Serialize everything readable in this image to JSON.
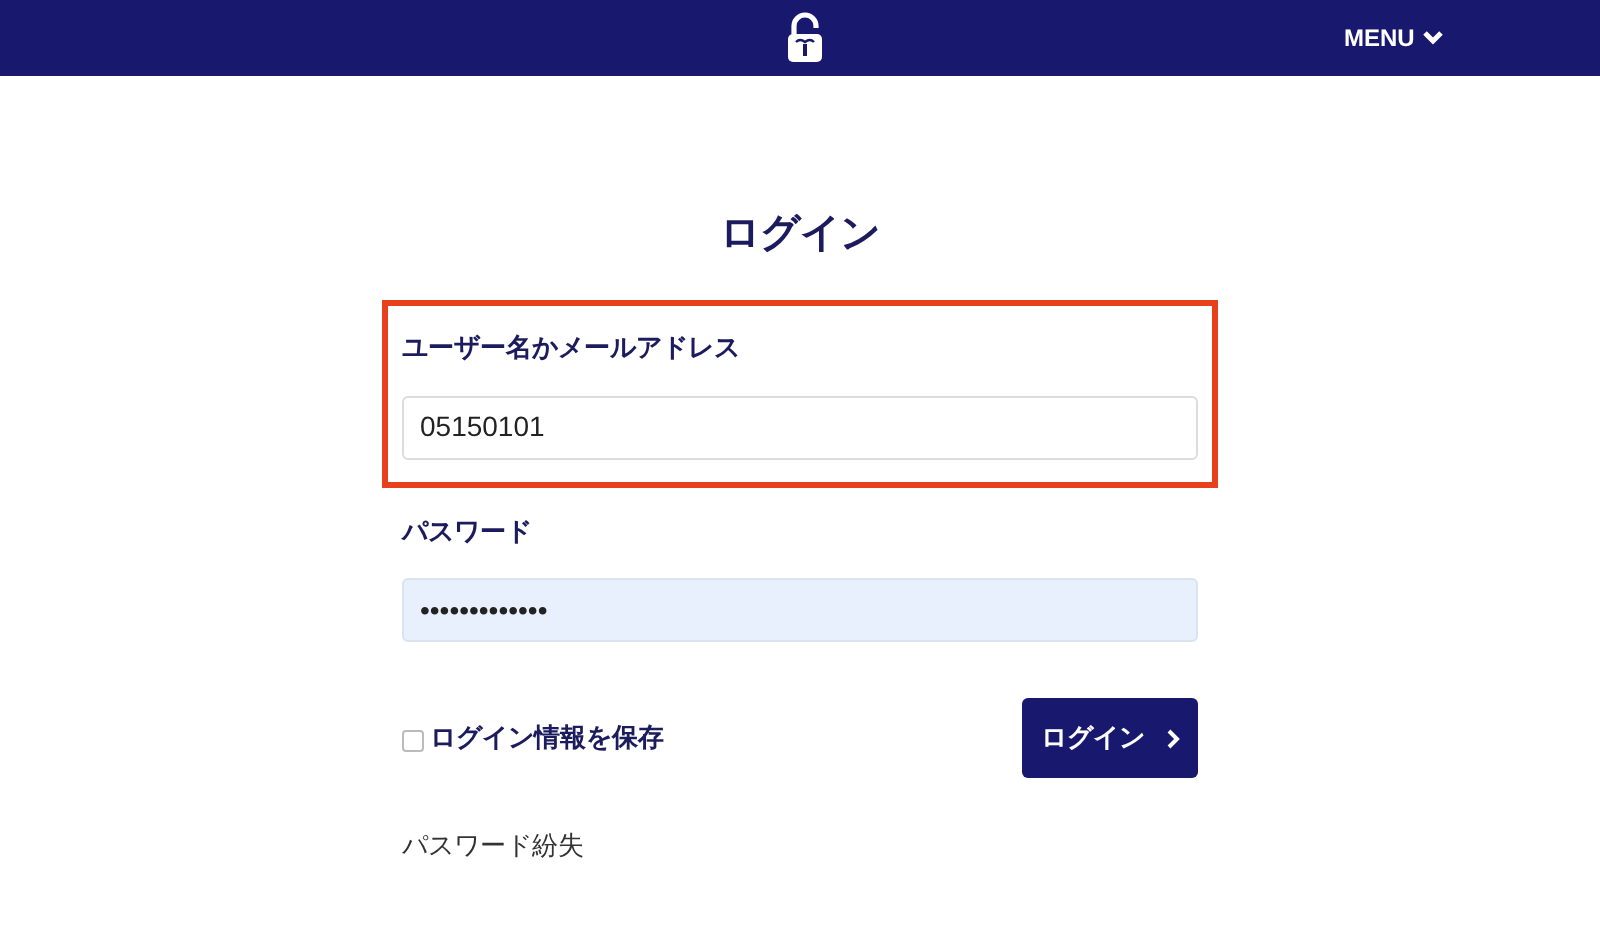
{
  "header": {
    "menu": {
      "label": "MENU",
      "expanded": false
    }
  },
  "title": "ログイン",
  "fields": [
    {
      "label": "ユーザー名かメールアドレス",
      "value": "05150101",
      "highlighted": true,
      "autofilled": false
    },
    {
      "label": "パスワード",
      "value": "•••••••••••••",
      "highlighted": false,
      "autofilled": true
    }
  ],
  "remember": {
    "label": "ログイン情報を保存",
    "checked": false
  },
  "submit": {
    "label": "ログイン"
  },
  "forgot_link": "パスワード紛失"
}
